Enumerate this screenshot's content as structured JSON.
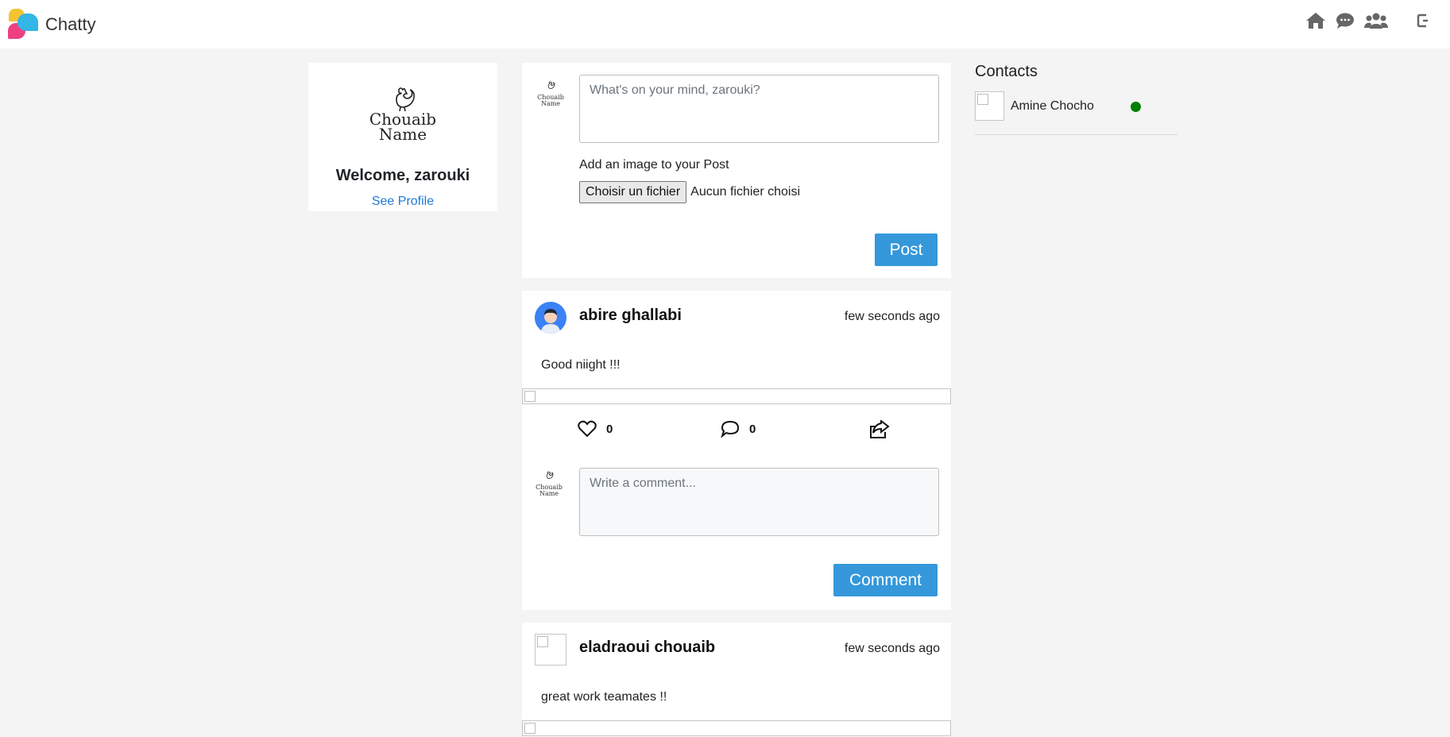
{
  "app": {
    "name": "Chatty"
  },
  "nav": {
    "icons": [
      "home-icon",
      "chat-icon",
      "users-icon",
      "logout-icon"
    ]
  },
  "profile": {
    "logo_lines": [
      "Chouaib",
      "Name"
    ],
    "welcome": "Welcome, zarouki",
    "see_profile": "See Profile"
  },
  "composer": {
    "logo_lines": [
      "Chouaib",
      "Name"
    ],
    "placeholder": "What's on your mind, zarouki?",
    "add_image_label": "Add an image to your Post",
    "file_button": "Choisir un fichier",
    "file_status": "Aucun fichier choisi",
    "post_button": "Post"
  },
  "posts": [
    {
      "author": "abire ghallabi",
      "time": "few seconds ago",
      "text": "Good niight !!!",
      "likes": "0",
      "comments": "0",
      "comment_placeholder": "Write a comment...",
      "comment_button": "Comment",
      "comment_logo_lines": [
        "Chouaib",
        "Name"
      ]
    },
    {
      "author": "eladraoui chouaib",
      "time": "few seconds ago",
      "text": "great work teamates !!"
    }
  ],
  "contacts": {
    "title": "Contacts",
    "items": [
      {
        "name": "Amine Chocho",
        "status": "online",
        "status_color": "#008000"
      }
    ]
  },
  "colors": {
    "accent": "#3498db",
    "link": "#1f7ad3",
    "background": "#f4f4f4"
  }
}
